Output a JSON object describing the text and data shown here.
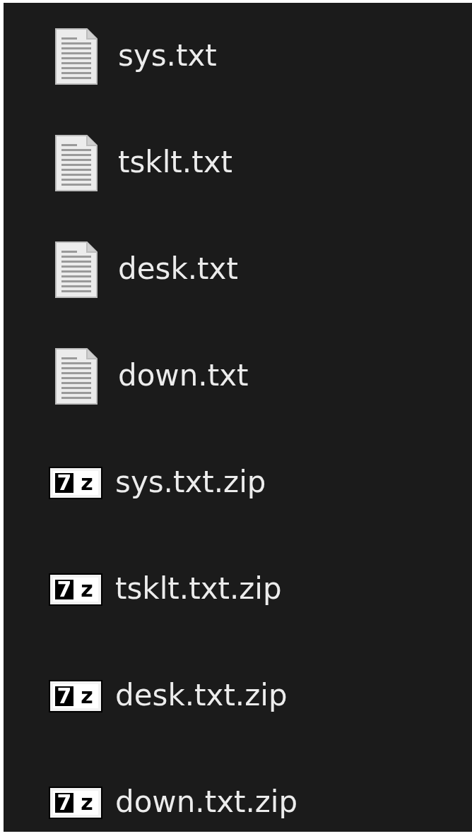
{
  "files": [
    {
      "kind": "text",
      "name": "sys.txt"
    },
    {
      "kind": "text",
      "name": "tsklt.txt"
    },
    {
      "kind": "text",
      "name": "desk.txt"
    },
    {
      "kind": "text",
      "name": "down.txt"
    },
    {
      "kind": "archive",
      "icon_chars": [
        "7",
        "z"
      ],
      "name": "sys.txt.zip"
    },
    {
      "kind": "archive",
      "icon_chars": [
        "7",
        "z"
      ],
      "name": "tsklt.txt.zip"
    },
    {
      "kind": "archive",
      "icon_chars": [
        "7",
        "z"
      ],
      "name": "desk.txt.zip"
    },
    {
      "kind": "archive",
      "icon_chars": [
        "7",
        "z"
      ],
      "name": "down.txt.zip"
    }
  ]
}
